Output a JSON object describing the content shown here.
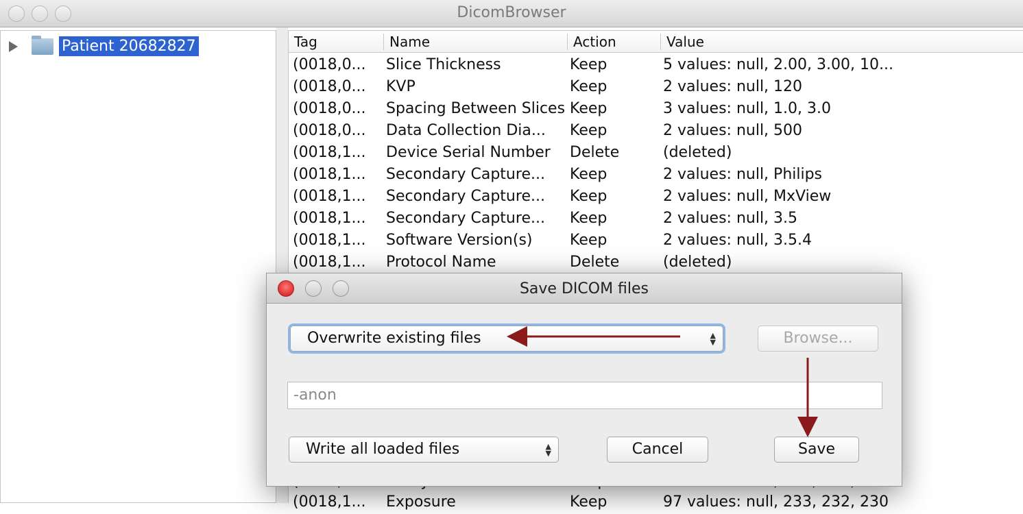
{
  "window": {
    "title": "DicomBrowser"
  },
  "tree": {
    "items": [
      {
        "label": "Patient 20682827",
        "selected": true
      }
    ]
  },
  "table": {
    "columns": [
      "Tag",
      "Name",
      "Action",
      "Value"
    ],
    "rows": [
      [
        "(0018,0...",
        "Slice Thickness",
        "Keep",
        "5 values: null, 2.00, 3.00, 10..."
      ],
      [
        "(0018,0...",
        "KVP",
        "Keep",
        "2 values: null, 120"
      ],
      [
        "(0018,0...",
        "Spacing Between Slices",
        "Keep",
        "3 values: null, 1.0, 3.0"
      ],
      [
        "(0018,0...",
        "Data Collection Dia...",
        "Keep",
        "2 values: null, 500"
      ],
      [
        "(0018,1...",
        "Device Serial Number",
        "Delete",
        "(deleted)"
      ],
      [
        "(0018,1...",
        "Secondary Capture...",
        "Keep",
        "2 values: null, Philips"
      ],
      [
        "(0018,1...",
        "Secondary Capture...",
        "Keep",
        "2 values: null, MxView"
      ],
      [
        "(0018,1...",
        "Secondary Capture...",
        "Keep",
        "2 values: null, 3.5"
      ],
      [
        "(0018,1...",
        "Software Version(s)",
        "Keep",
        "2 values: null, 3.5.4"
      ],
      [
        "(0018,1...",
        "Protocol Name",
        "Delete",
        "(deleted)"
      ]
    ],
    "partial_rows": [
      [
        "(0018,1...",
        "X-Ray Tube Current",
        "Keep",
        "97 values: null, 250, 257, 255..."
      ],
      [
        "(0018,1...",
        "Exposure",
        "Keep",
        "97 values: null, 233, 232, 230"
      ]
    ]
  },
  "dialog": {
    "title": "Save DICOM files",
    "mode_select": "Overwrite existing files",
    "browse_label": "Browse...",
    "suffix_value": "-anon",
    "scope_select": "Write all loaded files",
    "cancel_label": "Cancel",
    "save_label": "Save"
  },
  "annotation_color": "#8b1a1a"
}
